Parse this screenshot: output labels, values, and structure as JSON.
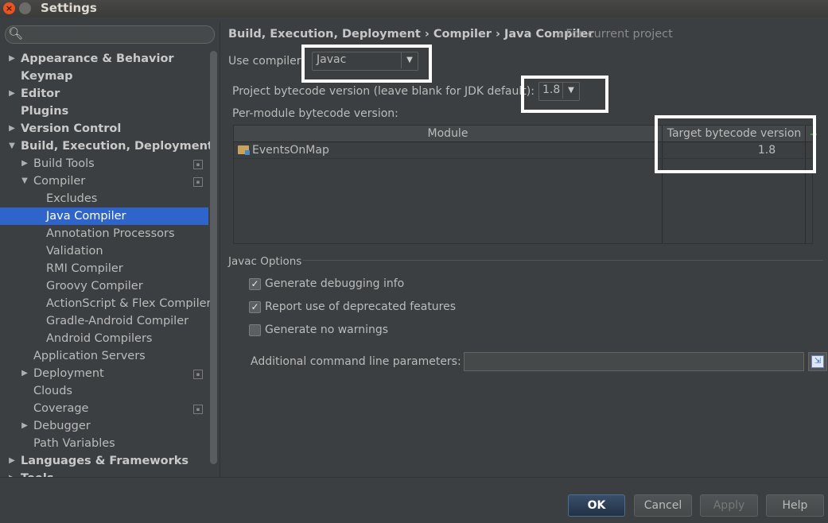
{
  "window": {
    "title": "Settings"
  },
  "sidebar": {
    "search_placeholder": "",
    "items": [
      {
        "label": "Appearance & Behavior",
        "level": 0,
        "bold": true,
        "expander": "collapsed"
      },
      {
        "label": "Keymap",
        "level": 0,
        "bold": true,
        "expander": "none"
      },
      {
        "label": "Editor",
        "level": 0,
        "bold": true,
        "expander": "collapsed"
      },
      {
        "label": "Plugins",
        "level": 0,
        "bold": true,
        "expander": "none"
      },
      {
        "label": "Version Control",
        "level": 0,
        "bold": true,
        "expander": "collapsed"
      },
      {
        "label": "Build, Execution, Deployment",
        "level": 0,
        "bold": true,
        "expander": "expanded"
      },
      {
        "label": "Build Tools",
        "level": 1,
        "expander": "collapsed",
        "project": true
      },
      {
        "label": "Compiler",
        "level": 1,
        "expander": "expanded",
        "project": true
      },
      {
        "label": "Excludes",
        "level": 2,
        "expander": "none"
      },
      {
        "label": "Java Compiler",
        "level": 2,
        "expander": "none",
        "selected": true
      },
      {
        "label": "Annotation Processors",
        "level": 2,
        "expander": "none"
      },
      {
        "label": "Validation",
        "level": 2,
        "expander": "none"
      },
      {
        "label": "RMI Compiler",
        "level": 2,
        "expander": "none"
      },
      {
        "label": "Groovy Compiler",
        "level": 2,
        "expander": "none"
      },
      {
        "label": "ActionScript & Flex Compiler",
        "level": 2,
        "expander": "none"
      },
      {
        "label": "Gradle-Android Compiler",
        "level": 2,
        "expander": "none"
      },
      {
        "label": "Android Compilers",
        "level": 2,
        "expander": "none"
      },
      {
        "label": "Application Servers",
        "level": 1,
        "expander": "none"
      },
      {
        "label": "Deployment",
        "level": 1,
        "expander": "collapsed",
        "project": true
      },
      {
        "label": "Clouds",
        "level": 1,
        "expander": "none"
      },
      {
        "label": "Coverage",
        "level": 1,
        "expander": "none",
        "project": true
      },
      {
        "label": "Debugger",
        "level": 1,
        "expander": "collapsed"
      },
      {
        "label": "Path Variables",
        "level": 1,
        "expander": "none"
      },
      {
        "label": "Languages & Frameworks",
        "level": 0,
        "bold": true,
        "expander": "collapsed"
      },
      {
        "label": "Tools",
        "level": 0,
        "bold": true,
        "expander": "collapsed"
      }
    ]
  },
  "breadcrumb": {
    "path": "Build, Execution, Deployment › Compiler › Java Compiler",
    "note": "For current project"
  },
  "compiler": {
    "use_compiler_label": "Use compiler:",
    "use_compiler_value": "Javac",
    "bytecode_label": "Project bytecode version (leave blank for JDK default):",
    "bytecode_value": "1.8",
    "per_module_label": "Per-module bytecode version:"
  },
  "module_table": {
    "headers": [
      "Module",
      "Target bytecode version"
    ],
    "rows": [
      {
        "module": "EventsOnMap",
        "version": "1.8"
      }
    ]
  },
  "javac_options": {
    "title": "Javac Options",
    "checkboxes": [
      {
        "label": "Generate debugging info",
        "checked": true
      },
      {
        "label": "Report use of deprecated features",
        "checked": true
      },
      {
        "label": "Generate no warnings",
        "checked": false
      }
    ],
    "additional_label": "Additional command line parameters:",
    "additional_value": ""
  },
  "footer": {
    "ok": "OK",
    "cancel": "Cancel",
    "apply": "Apply",
    "help": "Help"
  },
  "colors": {
    "selection": "#2f65ca",
    "background": "#3c3f41",
    "annotation_box": "#ffffff"
  }
}
